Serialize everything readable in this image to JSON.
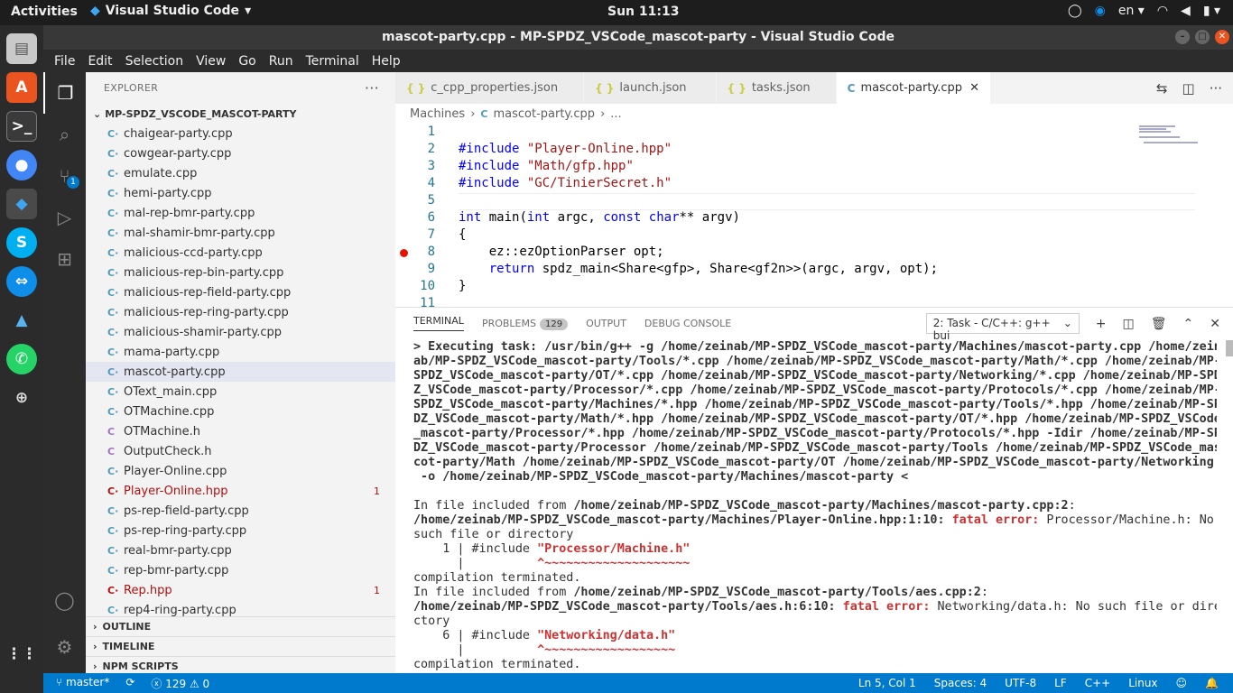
{
  "topbar": {
    "activities": "Activities",
    "app": "Visual Studio Code",
    "clock": "Sun 11:13",
    "lang": "en"
  },
  "window": {
    "title": "mascot-party.cpp - MP-SPDZ_VSCode_mascot-party - Visual Studio Code"
  },
  "menu": [
    "File",
    "Edit",
    "Selection",
    "View",
    "Go",
    "Run",
    "Terminal",
    "Help"
  ],
  "explorer": {
    "header": "EXPLORER",
    "folder": "MP-SPDZ_VSCODE_MASCOT-PARTY",
    "files": [
      {
        "name": "chaigear-party.cpp",
        "type": "cpp",
        "err": false,
        "count": ""
      },
      {
        "name": "cowgear-party.cpp",
        "type": "cpp",
        "err": false,
        "count": ""
      },
      {
        "name": "emulate.cpp",
        "type": "cpp",
        "err": false,
        "count": ""
      },
      {
        "name": "hemi-party.cpp",
        "type": "cpp",
        "err": false,
        "count": ""
      },
      {
        "name": "mal-rep-bmr-party.cpp",
        "type": "cpp",
        "err": false,
        "count": ""
      },
      {
        "name": "mal-shamir-bmr-party.cpp",
        "type": "cpp",
        "err": false,
        "count": ""
      },
      {
        "name": "malicious-ccd-party.cpp",
        "type": "cpp",
        "err": false,
        "count": ""
      },
      {
        "name": "malicious-rep-bin-party.cpp",
        "type": "cpp",
        "err": false,
        "count": ""
      },
      {
        "name": "malicious-rep-field-party.cpp",
        "type": "cpp",
        "err": false,
        "count": ""
      },
      {
        "name": "malicious-rep-ring-party.cpp",
        "type": "cpp",
        "err": false,
        "count": ""
      },
      {
        "name": "malicious-shamir-party.cpp",
        "type": "cpp",
        "err": false,
        "count": ""
      },
      {
        "name": "mama-party.cpp",
        "type": "cpp",
        "err": false,
        "count": ""
      },
      {
        "name": "mascot-party.cpp",
        "type": "cpp",
        "err": false,
        "count": "",
        "selected": true
      },
      {
        "name": "OText_main.cpp",
        "type": "cpp",
        "err": false,
        "count": ""
      },
      {
        "name": "OTMachine.cpp",
        "type": "cpp",
        "err": false,
        "count": ""
      },
      {
        "name": "OTMachine.h",
        "type": "h",
        "err": false,
        "count": ""
      },
      {
        "name": "OutputCheck.h",
        "type": "h",
        "err": false,
        "count": ""
      },
      {
        "name": "Player-Online.cpp",
        "type": "cpp",
        "err": false,
        "count": ""
      },
      {
        "name": "Player-Online.hpp",
        "type": "cpp",
        "err": true,
        "count": "1"
      },
      {
        "name": "ps-rep-field-party.cpp",
        "type": "cpp",
        "err": false,
        "count": ""
      },
      {
        "name": "ps-rep-ring-party.cpp",
        "type": "cpp",
        "err": false,
        "count": ""
      },
      {
        "name": "real-bmr-party.cpp",
        "type": "cpp",
        "err": false,
        "count": ""
      },
      {
        "name": "rep-bmr-party.cpp",
        "type": "cpp",
        "err": false,
        "count": ""
      },
      {
        "name": "Rep.hpp",
        "type": "cpp",
        "err": true,
        "count": "1"
      },
      {
        "name": "rep4-ring-party.cpp",
        "type": "cpp",
        "err": false,
        "count": ""
      }
    ],
    "sections": [
      "OUTLINE",
      "TIMELINE",
      "NPM SCRIPTS"
    ]
  },
  "tabs": [
    {
      "label": "c_cpp_properties.json",
      "icon": "{ }",
      "active": false
    },
    {
      "label": "launch.json",
      "icon": "{ }",
      "active": false
    },
    {
      "label": "tasks.json",
      "icon": "{ }",
      "active": false
    },
    {
      "label": "mascot-party.cpp",
      "icon": "C",
      "active": true
    }
  ],
  "breadcrumb": {
    "folder": "Machines",
    "file": "mascot-party.cpp",
    "more": "..."
  },
  "editor": {
    "lines": [
      {
        "n": "1",
        "html": ""
      },
      {
        "n": "2",
        "html": "<span class='pp'>#include</span> <span class='str'>\"Player-Online.hpp\"</span>"
      },
      {
        "n": "3",
        "html": "<span class='pp'>#include</span> <span class='str'>\"Math/gfp.hpp\"</span>"
      },
      {
        "n": "4",
        "html": "<span class='pp'>#include</span> <span class='str'>\"GC/TinierSecret.h\"</span>"
      },
      {
        "n": "5",
        "html": ""
      },
      {
        "n": "6",
        "html": "<span class='kw'>int</span> main(<span class='kw'>int</span> argc, <span class='kw'>const</span> <span class='kw'>char</span>** argv)"
      },
      {
        "n": "7",
        "html": "{"
      },
      {
        "n": "8",
        "html": "    ez::ezOptionParser opt;"
      },
      {
        "n": "9",
        "html": "    <span class='kw'>return</span> spdz_main&lt;Share&lt;gfp&gt;, Share&lt;gf2n&gt;&gt;(argc, argv, opt);"
      },
      {
        "n": "10",
        "html": "}"
      },
      {
        "n": "11",
        "html": ""
      }
    ]
  },
  "panel": {
    "tabs": [
      "TERMINAL",
      "PROBLEMS",
      "OUTPUT",
      "DEBUG CONSOLE"
    ],
    "problems_count": "129",
    "select": "2: Task - C/C++: g++ bui"
  },
  "terminal": {
    "lines": [
      "<span class='b'>&gt; Executing task: /usr/bin/g++ -g /home/zeinab/MP-SPDZ_VSCode_mascot-party/Machines/mascot-party.cpp /home/zein</span>",
      "<span class='b'>ab/MP-SPDZ_VSCode_mascot-party/Tools/*.cpp /home/zeinab/MP-SPDZ_VSCode_mascot-party/Math/*.cpp /home/zeinab/MP-</span>",
      "<span class='b'>SPDZ_VSCode_mascot-party/OT/*.cpp /home/zeinab/MP-SPDZ_VSCode_mascot-party/Networking/*.cpp /home/zeinab/MP-SPD</span>",
      "<span class='b'>Z_VSCode_mascot-party/Processor/*.cpp /home/zeinab/MP-SPDZ_VSCode_mascot-party/Protocols/*.cpp /home/zeinab/MP-</span>",
      "<span class='b'>SPDZ_VSCode_mascot-party/Machines/*.hpp /home/zeinab/MP-SPDZ_VSCode_mascot-party/Tools/*.hpp /home/zeinab/MP-SP</span>",
      "<span class='b'>DZ_VSCode_mascot-party/Math/*.hpp /home/zeinab/MP-SPDZ_VSCode_mascot-party/OT/*.hpp /home/zeinab/MP-SPDZ_VSCode</span>",
      "<span class='b'>_mascot-party/Processor/*.hpp /home/zeinab/MP-SPDZ_VSCode_mascot-party/Protocols/*.hpp -Idir /home/zeinab/MP-SP</span>",
      "<span class='b'>DZ_VSCode_mascot-party/Processor /home/zeinab/MP-SPDZ_VSCode_mascot-party/Tools /home/zeinab/MP-SPDZ_VSCode_mas</span>",
      "<span class='b'>cot-party/Math /home/zeinab/MP-SPDZ_VSCode_mascot-party/OT /home/zeinab/MP-SPDZ_VSCode_mascot-party/Networking</span>",
      "<span class='b'> -o /home/zeinab/MP-SPDZ_VSCode_mascot-party/Machines/mascot-party &lt;</span>",
      "",
      "In file included from <span class='b'>/home/zeinab/MP-SPDZ_VSCode_mascot-party/Machines/mascot-party.cpp:2</span>:",
      "<span class='b'>/home/zeinab/MP-SPDZ_VSCode_mascot-party/Machines/Player-Online.hpp:1:10:</span> <span class='red'>fatal error:</span> Processor/Machine.h: No",
      "such file or directory",
      "    1 | #include <span class='red'>\"Processor/Machine.h\"</span>",
      "      |          <span class='red'>^~~~~~~~~~~~~~~~~~~~~</span>",
      "compilation terminated.",
      "In file included from <span class='b'>/home/zeinab/MP-SPDZ_VSCode_mascot-party/Tools/aes.cpp:2</span>:",
      "<span class='b'>/home/zeinab/MP-SPDZ_VSCode_mascot-party/Tools/aes.h:6:10:</span> <span class='red'>fatal error:</span> Networking/data.h: No such file or dire",
      "ctory",
      "    6 | #include <span class='red'>\"Networking/data.h\"</span>",
      "      |          <span class='red'>^~~~~~~~~~~~~~~~~~~</span>",
      "compilation terminated."
    ]
  },
  "status": {
    "branch": "master*",
    "sync": "⟳",
    "errors": "129",
    "warnings": "0",
    "position": "Ln 5, Col 1",
    "spaces": "Spaces: 4",
    "encoding": "UTF-8",
    "eol": "LF",
    "language": "C++",
    "os": "Linux"
  }
}
